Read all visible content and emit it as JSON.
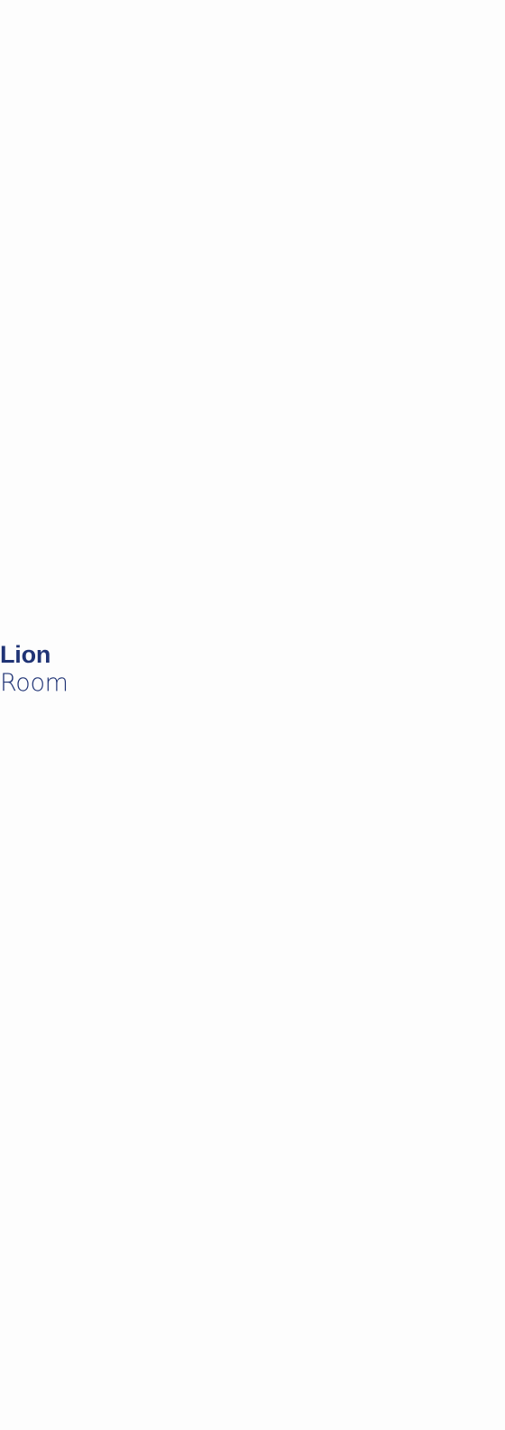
{
  "room": {
    "name_bold": "Lion",
    "name_light": "Room"
  },
  "colors": {
    "title_text": "#1f3375",
    "background": "#fdfdfd"
  }
}
